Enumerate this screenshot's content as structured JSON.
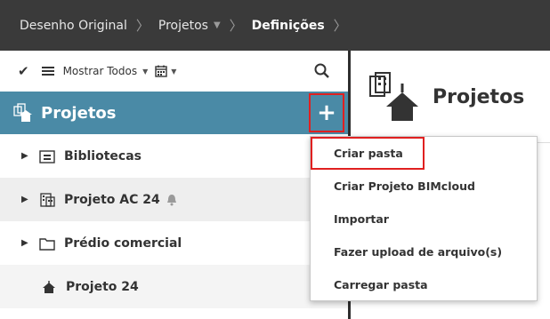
{
  "breadcrumb": {
    "items": [
      {
        "label": "Desenho Original"
      },
      {
        "label": "Projetos"
      },
      {
        "label": "Definições"
      }
    ]
  },
  "toolbar": {
    "filter_label": "Mostrar Todos"
  },
  "sidebar": {
    "header_title": "Projetos",
    "add_label": "+",
    "items": [
      {
        "label": "Bibliotecas"
      },
      {
        "label": "Projeto AC 24"
      },
      {
        "label": "Prédio comercial"
      },
      {
        "label": "Projeto 24"
      }
    ]
  },
  "main": {
    "title": "Projetos"
  },
  "context_menu": {
    "items": [
      {
        "label": "Criar pasta"
      },
      {
        "label": "Criar Projeto BIMcloud"
      },
      {
        "label": "Importar"
      },
      {
        "label": "Fazer upload de arquivo(s)"
      },
      {
        "label": "Carregar pasta"
      }
    ]
  },
  "colors": {
    "header_bar": "#3a3a3a",
    "accent": "#4a8aa6",
    "highlight_outline": "#e02020"
  }
}
